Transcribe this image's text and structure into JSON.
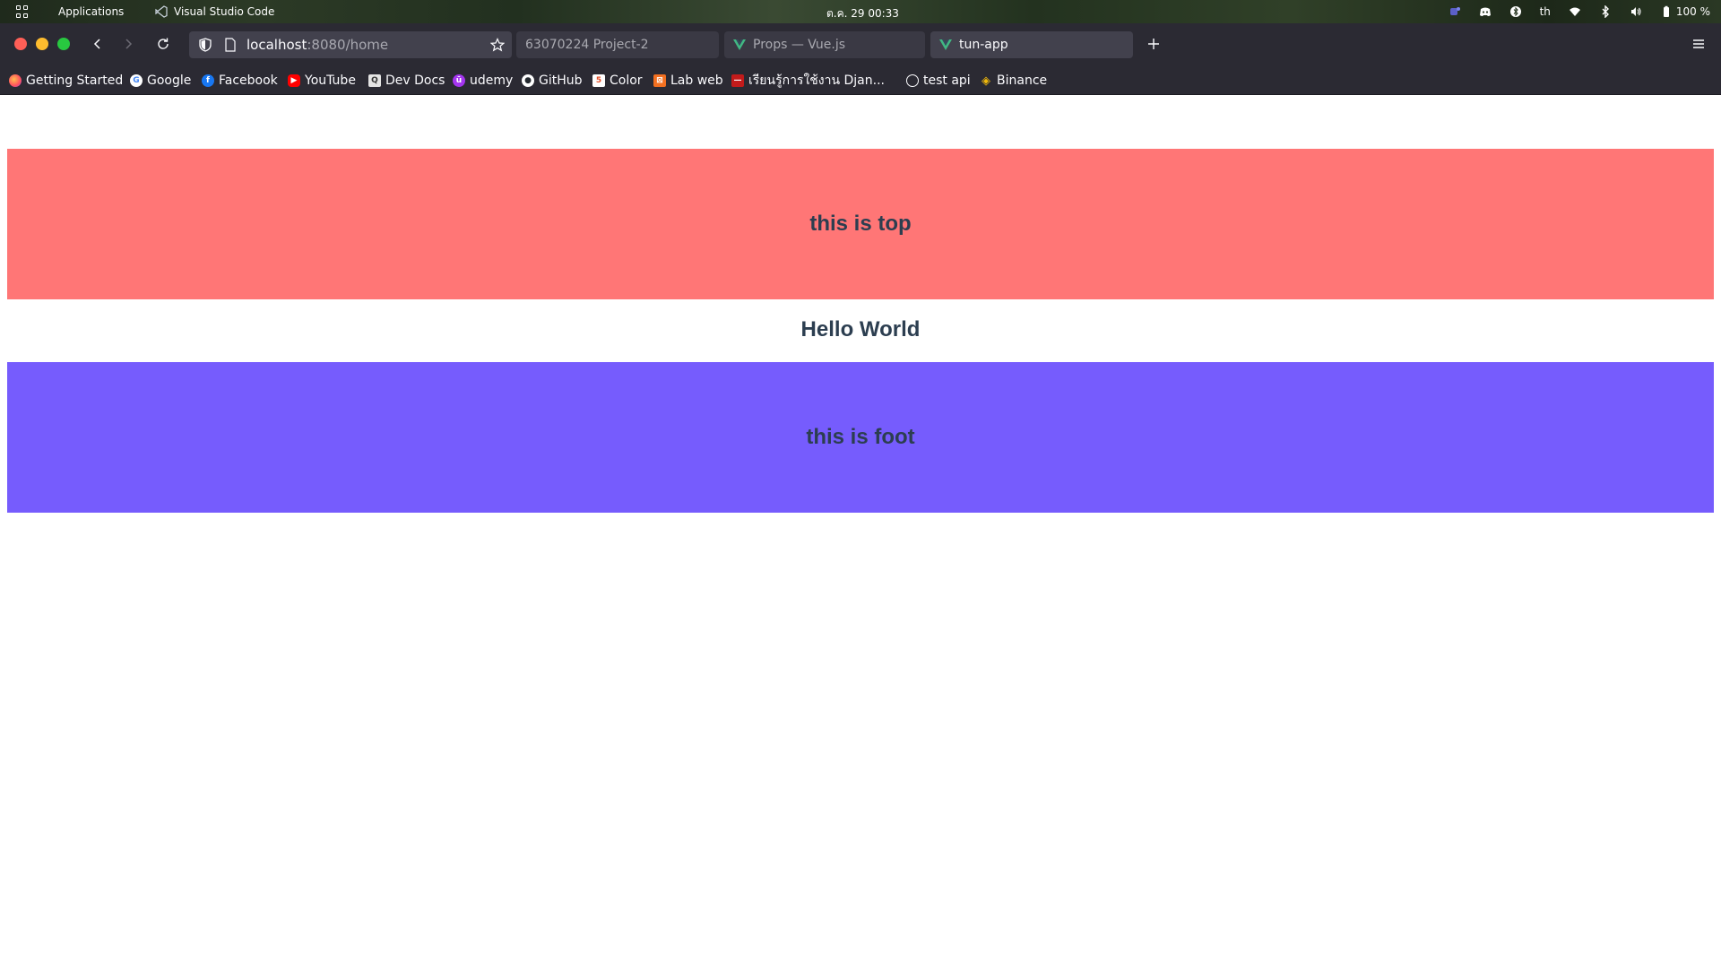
{
  "os_bar": {
    "applications_label": "Applications",
    "active_app_label": "Visual Studio Code",
    "clock": "ต.ค. 29  00:33",
    "language": "th",
    "battery": "100 %"
  },
  "browser": {
    "url_host": "localhost",
    "url_rest": ":8080/home",
    "tabs": [
      {
        "label": "63070224 Project-2",
        "icon": "none"
      },
      {
        "label": "Props — Vue.js",
        "icon": "vue-icon"
      },
      {
        "label": "tun-app",
        "icon": "vue-icon"
      }
    ],
    "bookmarks": [
      {
        "label": "Getting Started",
        "icon": "firefox-icon"
      },
      {
        "label": "Google",
        "icon": "google-icon"
      },
      {
        "label": "Facebook",
        "icon": "facebook-icon"
      },
      {
        "label": "YouTube",
        "icon": "youtube-icon"
      },
      {
        "label": "Dev Docs",
        "icon": "devdocs-icon"
      },
      {
        "label": "udemy",
        "icon": "udemy-icon"
      },
      {
        "label": "GitHub",
        "icon": "github-icon"
      },
      {
        "label": "Color",
        "icon": "color-icon"
      },
      {
        "label": "Lab web",
        "icon": "labweb-icon"
      },
      {
        "label": "เรียนรู้การใช้งาน Djan...",
        "icon": "django-icon"
      },
      {
        "label": "test api",
        "icon": "globe-icon"
      },
      {
        "label": "Binance",
        "icon": "binance-icon"
      }
    ]
  },
  "page": {
    "top_text": "this is top",
    "hello_text": "Hello World",
    "foot_text": "this is foot"
  },
  "colors": {
    "top_block": "#ff7676",
    "foot_block": "#765cfd",
    "text": "#2c3e50",
    "vue_green": "#41b883"
  }
}
